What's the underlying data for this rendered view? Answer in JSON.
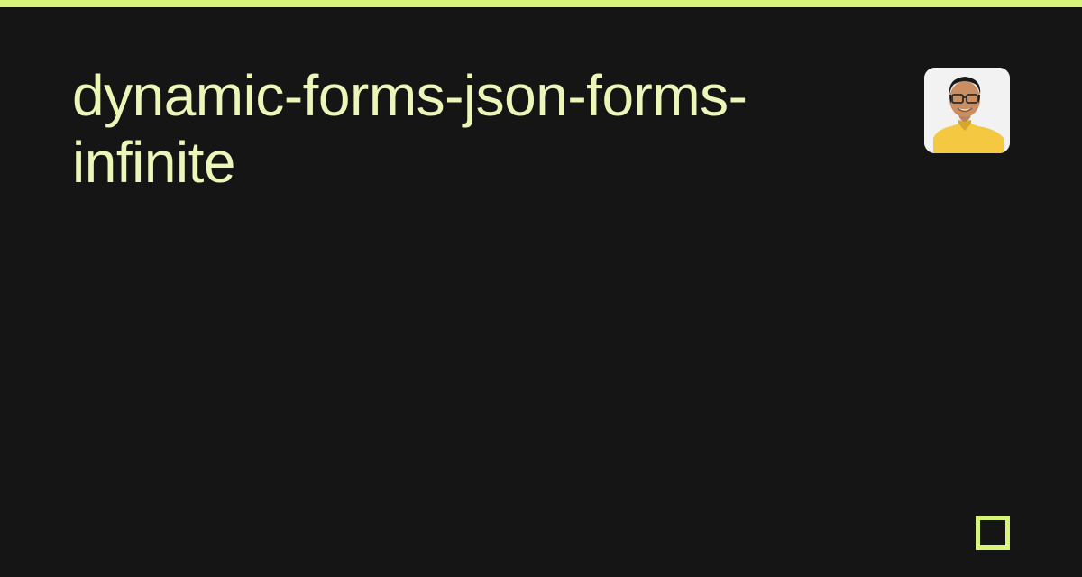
{
  "colors": {
    "accent": "#d8f57a",
    "title": "#ebf7b8",
    "background": "#151515"
  },
  "title": "dynamic-forms-json-forms-infinite",
  "avatar": {
    "description": "person-in-yellow-shirt-with-glasses"
  },
  "icons": {
    "corner": "square-outline-icon"
  }
}
